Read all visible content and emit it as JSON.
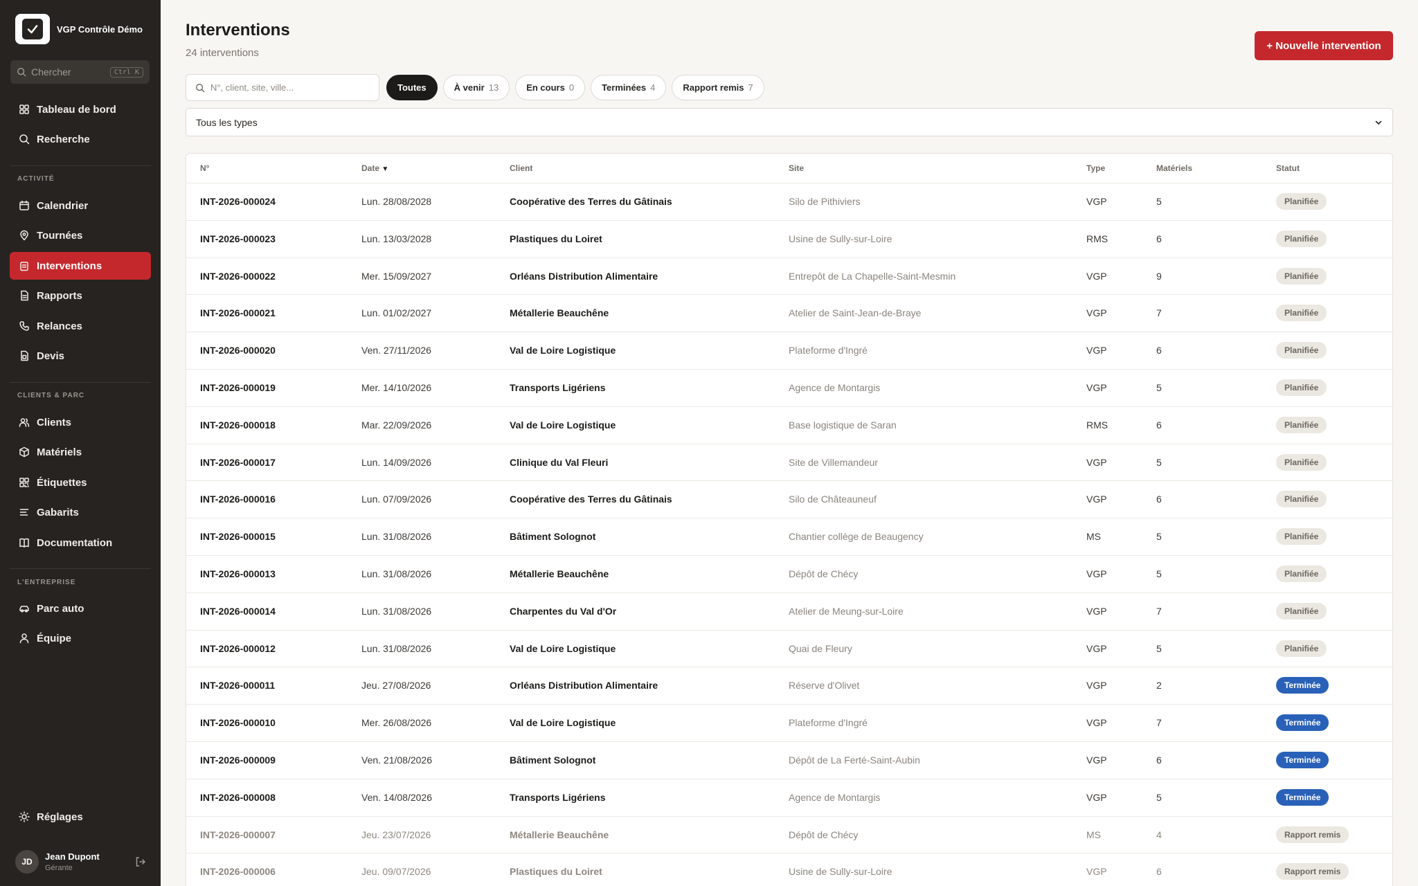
{
  "brand": {
    "name": "VGP Contrôle Démo"
  },
  "sidebar": {
    "search_label": "Chercher",
    "search_shortcut": "Ctrl K",
    "top_items": [
      {
        "label": "Tableau de bord",
        "icon": "grid-icon"
      },
      {
        "label": "Recherche",
        "icon": "search-icon"
      }
    ],
    "sections": [
      {
        "label": "ACTIVITÉ",
        "items": [
          {
            "label": "Calendrier",
            "icon": "calendar-icon"
          },
          {
            "label": "Tournées",
            "icon": "map-pin-icon"
          },
          {
            "label": "Interventions",
            "icon": "clipboard-icon",
            "active": true
          },
          {
            "label": "Rapports",
            "icon": "file-icon"
          },
          {
            "label": "Relances",
            "icon": "phone-icon"
          },
          {
            "label": "Devis",
            "icon": "quote-icon"
          }
        ]
      },
      {
        "label": "CLIENTS & PARC",
        "items": [
          {
            "label": "Clients",
            "icon": "users-icon"
          },
          {
            "label": "Matériels",
            "icon": "box-icon"
          },
          {
            "label": "Étiquettes",
            "icon": "qr-icon"
          },
          {
            "label": "Gabarits",
            "icon": "list-icon"
          },
          {
            "label": "Documentation",
            "icon": "book-icon"
          }
        ]
      },
      {
        "label": "L'ENTREPRISE",
        "items": [
          {
            "label": "Parc auto",
            "icon": "car-icon"
          },
          {
            "label": "Équipe",
            "icon": "user-icon"
          }
        ]
      }
    ],
    "settings_label": "Réglages",
    "user": {
      "initials": "JD",
      "name": "Jean Dupont",
      "role": "Gérante"
    }
  },
  "header": {
    "title": "Interventions",
    "subtitle": "24 interventions",
    "new_button": "+ Nouvelle intervention"
  },
  "filters": {
    "search_placeholder": "N°, client, site, ville...",
    "chips": [
      {
        "label": "Toutes",
        "count": "",
        "active": true
      },
      {
        "label": "À venir",
        "count": "13"
      },
      {
        "label": "En cours",
        "count": "0"
      },
      {
        "label": "Terminées",
        "count": "4"
      },
      {
        "label": "Rapport remis",
        "count": "7"
      }
    ],
    "type_select": "Tous les types"
  },
  "table": {
    "columns": [
      "N°",
      "Date",
      "Client",
      "Site",
      "Type",
      "Matériels",
      "Statut"
    ],
    "sort_indicator": "▼",
    "rows": [
      {
        "num": "INT-2026-000024",
        "date": "Lun. 28/08/2028",
        "client": "Coopérative des Terres du Gâtinais",
        "site": "Silo de Pithiviers",
        "type": "VGP",
        "mat": "5",
        "status": "Planifiée",
        "kind": "planifiee"
      },
      {
        "num": "INT-2026-000023",
        "date": "Lun. 13/03/2028",
        "client": "Plastiques du Loiret",
        "site": "Usine de Sully-sur-Loire",
        "type": "RMS",
        "mat": "6",
        "status": "Planifiée",
        "kind": "planifiee"
      },
      {
        "num": "INT-2026-000022",
        "date": "Mer. 15/09/2027",
        "client": "Orléans Distribution Alimentaire",
        "site": "Entrepôt de La Chapelle-Saint-Mesmin",
        "type": "VGP",
        "mat": "9",
        "status": "Planifiée",
        "kind": "planifiee"
      },
      {
        "num": "INT-2026-000021",
        "date": "Lun. 01/02/2027",
        "client": "Métallerie Beauchêne",
        "site": "Atelier de Saint-Jean-de-Braye",
        "type": "VGP",
        "mat": "7",
        "status": "Planifiée",
        "kind": "planifiee"
      },
      {
        "num": "INT-2026-000020",
        "date": "Ven. 27/11/2026",
        "client": "Val de Loire Logistique",
        "site": "Plateforme d'Ingré",
        "type": "VGP",
        "mat": "6",
        "status": "Planifiée",
        "kind": "planifiee"
      },
      {
        "num": "INT-2026-000019",
        "date": "Mer. 14/10/2026",
        "client": "Transports Ligériens",
        "site": "Agence de Montargis",
        "type": "VGP",
        "mat": "5",
        "status": "Planifiée",
        "kind": "planifiee"
      },
      {
        "num": "INT-2026-000018",
        "date": "Mar. 22/09/2026",
        "client": "Val de Loire Logistique",
        "site": "Base logistique de Saran",
        "type": "RMS",
        "mat": "6",
        "status": "Planifiée",
        "kind": "planifiee"
      },
      {
        "num": "INT-2026-000017",
        "date": "Lun. 14/09/2026",
        "client": "Clinique du Val Fleuri",
        "site": "Site de Villemandeur",
        "type": "VGP",
        "mat": "5",
        "status": "Planifiée",
        "kind": "planifiee"
      },
      {
        "num": "INT-2026-000016",
        "date": "Lun. 07/09/2026",
        "client": "Coopérative des Terres du Gâtinais",
        "site": "Silo de Châteauneuf",
        "type": "VGP",
        "mat": "6",
        "status": "Planifiée",
        "kind": "planifiee"
      },
      {
        "num": "INT-2026-000015",
        "date": "Lun. 31/08/2026",
        "client": "Bâtiment Solognot",
        "site": "Chantier collège de Beaugency",
        "type": "MS",
        "mat": "5",
        "status": "Planifiée",
        "kind": "planifiee"
      },
      {
        "num": "INT-2026-000013",
        "date": "Lun. 31/08/2026",
        "client": "Métallerie Beauchêne",
        "site": "Dépôt de Chécy",
        "type": "VGP",
        "mat": "5",
        "status": "Planifiée",
        "kind": "planifiee"
      },
      {
        "num": "INT-2026-000014",
        "date": "Lun. 31/08/2026",
        "client": "Charpentes du Val d'Or",
        "site": "Atelier de Meung-sur-Loire",
        "type": "VGP",
        "mat": "7",
        "status": "Planifiée",
        "kind": "planifiee"
      },
      {
        "num": "INT-2026-000012",
        "date": "Lun. 31/08/2026",
        "client": "Val de Loire Logistique",
        "site": "Quai de Fleury",
        "type": "VGP",
        "mat": "5",
        "status": "Planifiée",
        "kind": "planifiee"
      },
      {
        "num": "INT-2026-000011",
        "date": "Jeu. 27/08/2026",
        "client": "Orléans Distribution Alimentaire",
        "site": "Réserve d'Olivet",
        "type": "VGP",
        "mat": "2",
        "status": "Terminée",
        "kind": "terminee"
      },
      {
        "num": "INT-2026-000010",
        "date": "Mer. 26/08/2026",
        "client": "Val de Loire Logistique",
        "site": "Plateforme d'Ingré",
        "type": "VGP",
        "mat": "7",
        "status": "Terminée",
        "kind": "terminee"
      },
      {
        "num": "INT-2026-000009",
        "date": "Ven. 21/08/2026",
        "client": "Bâtiment Solognot",
        "site": "Dépôt de La Ferté-Saint-Aubin",
        "type": "VGP",
        "mat": "6",
        "status": "Terminée",
        "kind": "terminee"
      },
      {
        "num": "INT-2026-000008",
        "date": "Ven. 14/08/2026",
        "client": "Transports Ligériens",
        "site": "Agence de Montargis",
        "type": "VGP",
        "mat": "5",
        "status": "Terminée",
        "kind": "terminee"
      },
      {
        "num": "INT-2026-000007",
        "date": "Jeu. 23/07/2026",
        "client": "Métallerie Beauchêne",
        "site": "Dépôt de Chécy",
        "type": "MS",
        "mat": "4",
        "status": "Rapport remis",
        "kind": "rapport"
      },
      {
        "num": "INT-2026-000006",
        "date": "Jeu. 09/07/2026",
        "client": "Plastiques du Loiret",
        "site": "Usine de Sully-sur-Loire",
        "type": "VGP",
        "mat": "6",
        "status": "Rapport remis",
        "kind": "rapport"
      }
    ]
  },
  "colors": {
    "accent": "#c5282c",
    "sidebar": "#262320",
    "done": "#2a61b8"
  }
}
